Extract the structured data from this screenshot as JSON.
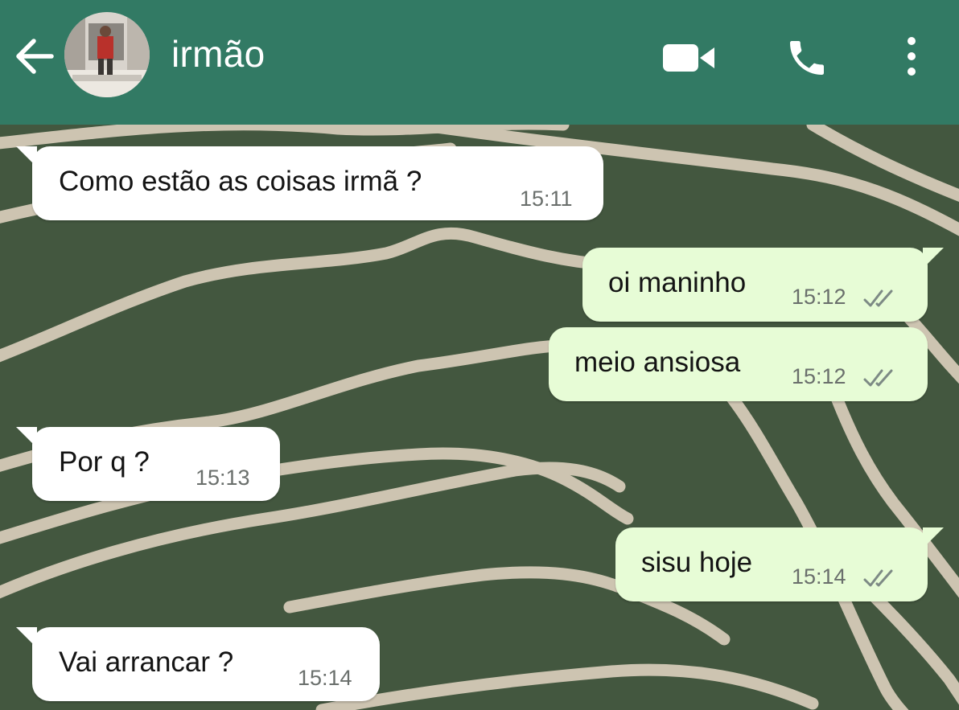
{
  "header": {
    "contact_name": "irmão",
    "background_color": "#327a64",
    "icons": {
      "back": "arrow-back-icon",
      "avatar": "contact-avatar",
      "video": "video-camera-icon",
      "call": "phone-icon",
      "menu": "more-vertical-icon"
    }
  },
  "chat": {
    "wallpaper_colors": {
      "base": "#43573f",
      "lines": "#cfc6b3"
    },
    "messages": [
      {
        "direction": "incoming",
        "text": "Como estão as coisas irmã ?",
        "time": "15:11"
      },
      {
        "direction": "outgoing",
        "text": "oi maninho",
        "time": "15:12",
        "status": "read"
      },
      {
        "direction": "outgoing",
        "text": "meio ansiosa",
        "time": "15:12",
        "status": "read"
      },
      {
        "direction": "incoming",
        "text": "Por q ?",
        "time": "15:13"
      },
      {
        "direction": "outgoing",
        "text": "sisu hoje",
        "time": "15:14",
        "status": "read"
      },
      {
        "direction": "incoming",
        "text": "Vai arrancar ?",
        "time": "15:14"
      }
    ],
    "bubble_colors": {
      "incoming": "#ffffff",
      "outgoing": "#e7fcd6"
    }
  }
}
